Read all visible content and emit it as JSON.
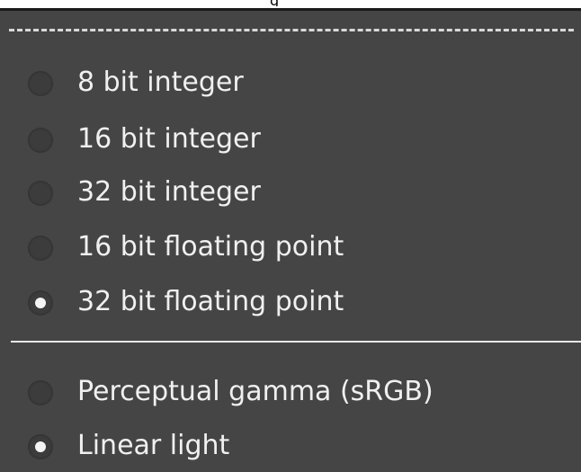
{
  "titlebar": {
    "fragment": "g"
  },
  "menu": {
    "precision_items": [
      {
        "label": "8 bit integer",
        "checked": false
      },
      {
        "label": "16 bit integer",
        "checked": false
      },
      {
        "label": "32 bit integer",
        "checked": false
      },
      {
        "label": "16 bit floating point",
        "checked": false
      },
      {
        "label": "32 bit floating point",
        "checked": true
      }
    ],
    "gamma_items": [
      {
        "label": "Perceptual gamma (sRGB)",
        "checked": false
      },
      {
        "label": "Linear light",
        "checked": true
      }
    ]
  },
  "colors": {
    "menu_background": "#454545",
    "label_text": "#f0f0f0",
    "radio_well": "#3c3c3c",
    "radio_dot": "#f4f4f4",
    "separator": "#e6e6e6"
  }
}
